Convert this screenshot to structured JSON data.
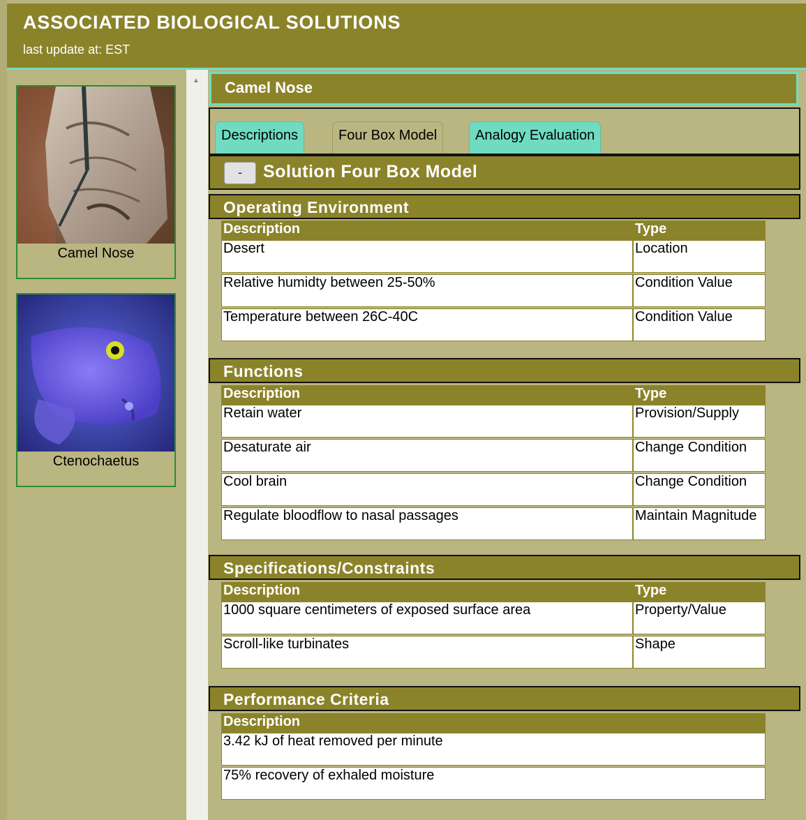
{
  "header": {
    "title": "ASSOCIATED BIOLOGICAL SOLUTIONS",
    "last_update": "last update at: EST"
  },
  "sidebar": {
    "items": [
      {
        "label": "Camel Nose",
        "image": "camel-nose-photo"
      },
      {
        "label": "Ctenochaetus",
        "image": "blue-fish-photo"
      }
    ]
  },
  "solution": {
    "title": "Camel Nose",
    "tabs": [
      {
        "label": "Descriptions",
        "active": false
      },
      {
        "label": "Four Box Model",
        "active": true
      },
      {
        "label": "Analogy Evaluation",
        "active": false
      }
    ],
    "collapse_label": "-",
    "section_title": "Solution Four Box Model"
  },
  "sections": {
    "operating_environment": {
      "title": "Operating Environment",
      "columns": [
        "Description",
        "Type"
      ],
      "rows": [
        [
          "Desert",
          "Location"
        ],
        [
          "Relative humidty between 25-50%",
          "Condition Value"
        ],
        [
          "Temperature between 26C-40C",
          "Condition Value"
        ]
      ]
    },
    "functions": {
      "title": "Functions",
      "columns": [
        "Description",
        "Type"
      ],
      "rows": [
        [
          "Retain water",
          "Provision/Supply"
        ],
        [
          "Desaturate air",
          "Change Condition"
        ],
        [
          "Cool brain",
          "Change Condition"
        ],
        [
          "Regulate bloodflow to nasal passages",
          "Maintain Magnitude"
        ]
      ]
    },
    "specifications": {
      "title": "Specifications/Constraints",
      "columns": [
        "Description",
        "Type"
      ],
      "rows": [
        [
          "1000 square centimeters of exposed surface area",
          "Property/Value"
        ],
        [
          "Scroll-like turbinates",
          "Shape"
        ]
      ]
    },
    "performance": {
      "title": "Performance Criteria",
      "columns": [
        "Description"
      ],
      "rows": [
        [
          "3.42 kJ of heat removed per minute"
        ],
        [
          "75% recovery of exhaled moisture"
        ]
      ]
    }
  },
  "colors": {
    "olive": "#8b832a",
    "background": "#bab682",
    "accent": "#6fdcc2"
  }
}
